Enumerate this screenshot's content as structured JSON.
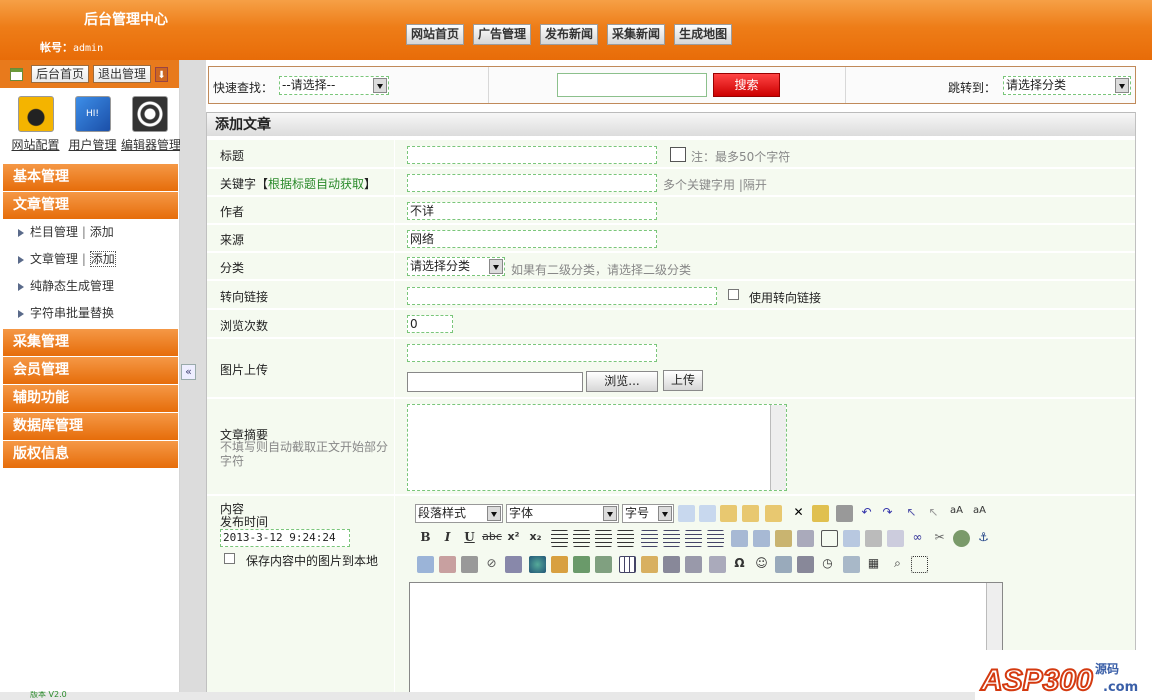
{
  "header": {
    "title": "后台管理中心",
    "account_label": "帐号：",
    "account": "admin"
  },
  "topnav": [
    "网站首页",
    "广告管理",
    "发布新闻",
    "采集新闻",
    "生成地图"
  ],
  "sidebar": {
    "top_buttons": [
      "后台首页",
      "退出管理"
    ],
    "quick_icons": [
      {
        "label": "网站配置",
        "icon": "bird-icon",
        "color": "#f0b000"
      },
      {
        "label": "用户管理",
        "icon": "users-icon",
        "color": "#2a6fcf"
      },
      {
        "label": "编辑器管理",
        "icon": "editor-icon",
        "color": "#555555"
      }
    ],
    "menus": [
      "基本管理",
      "文章管理",
      "采集管理",
      "会员管理",
      "辅助功能",
      "数据库管理",
      "版权信息"
    ],
    "article_sub": [
      {
        "a": "栏目管理",
        "sep": "|",
        "b": "添加"
      },
      {
        "a": "文章管理",
        "sep": "|",
        "b": "添加"
      },
      {
        "a": "纯静态生成管理"
      },
      {
        "a": "字符串批量替换"
      }
    ],
    "collapse": "«"
  },
  "quickbar": {
    "search_label": "快速查找：",
    "search_select": "--请选择--",
    "search_button": "搜索",
    "jump_label": "跳转到：",
    "jump_select": "请选择分类"
  },
  "form": {
    "heading": "添加文章",
    "title_label": "标题",
    "title_hint": "注：最多50个字符",
    "keyword_label": "关键字",
    "keyword_link": "根据标题自动获取",
    "keyword_hint": "多个关键字用 |隔开",
    "author_label": "作者",
    "author_value": "不详",
    "source_label": "来源",
    "source_value": "网络",
    "category_label": "分类",
    "category_select": "请选择分类",
    "category_hint": "如果有二级分类，请选择二级分类",
    "redirect_label": "转向链接",
    "redirect_check": "使用转向链接",
    "views_label": "浏览次数",
    "views_value": "0",
    "image_label": "图片上传",
    "browse_button": "浏览...",
    "upload_button": "上传",
    "summary_label": "文章摘要",
    "summary_hint": "不填写则自动截取正文开始部分字符",
    "content_label": "内容",
    "pubtime_label": "发布时间",
    "pubtime_value": "2013-3-12 9:24:24",
    "save_images": "保存内容中的图片到本地",
    "editor": {
      "style": "段落样式",
      "font": "字体",
      "size": "字号",
      "bold": "B",
      "italic": "I",
      "underline": "U",
      "strike": "abc",
      "sup": "x²",
      "sub": "x₂"
    }
  },
  "footer": {
    "version": "版本 V2.0"
  },
  "watermark": {
    "brand": "ASP300",
    "cn": "源码",
    "domain": ".com"
  }
}
